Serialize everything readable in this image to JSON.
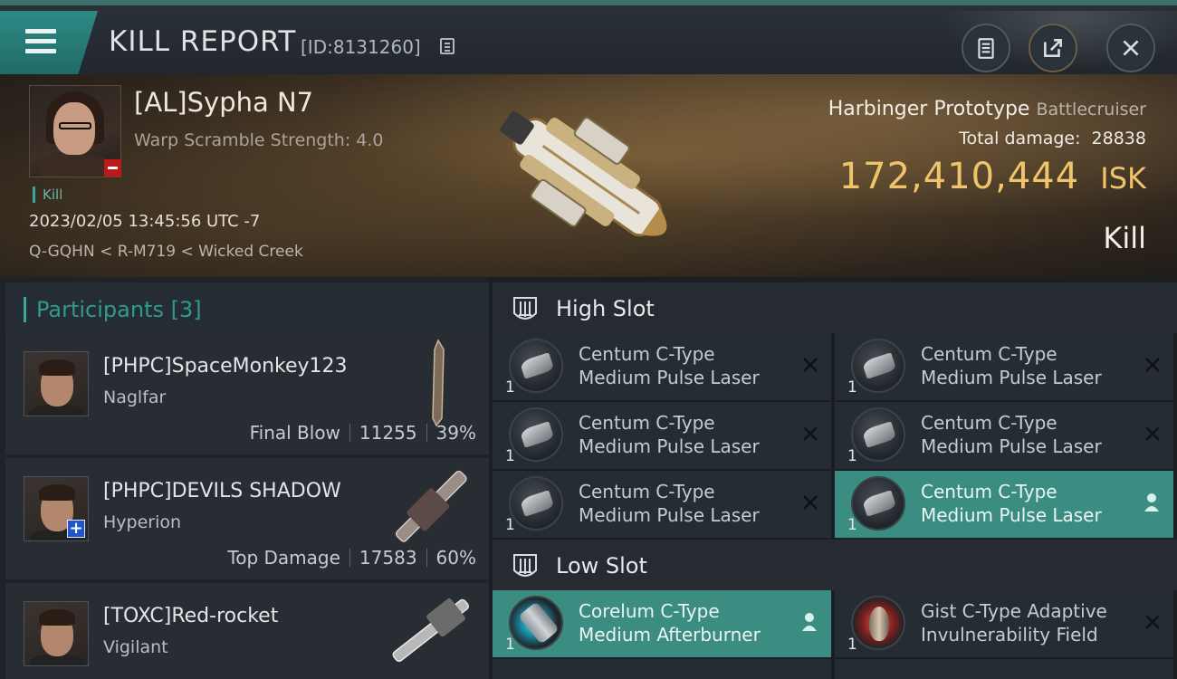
{
  "header": {
    "title": "KILL REPORT",
    "report_id": "[ID:8131260]"
  },
  "victim": {
    "name": "[AL]Sypha N7",
    "warp_scramble": "Warp Scramble Strength: 4.0",
    "tag": "Kill",
    "datetime": "2023/02/05 13:45:56 UTC -7",
    "location": "Q-GQHN < R-M719 < Wicked Creek",
    "ship_name": "Harbinger Prototype",
    "ship_class": "Battlecruiser",
    "total_damage_label": "Total damage:",
    "total_damage": "28838",
    "isk_value": "172,410,444",
    "isk_unit": "ISK",
    "result": "Kill"
  },
  "participants": {
    "title": "Participants [3]",
    "rows": [
      {
        "name": "[PHPC]SpaceMonkey123",
        "ship": "Naglfar",
        "role": "Final Blow",
        "damage": "11255",
        "percent": "39%"
      },
      {
        "name": "[PHPC]DEVILS SHADOW",
        "ship": "Hyperion",
        "role": "Top Damage",
        "damage": "17583",
        "percent": "60%"
      },
      {
        "name": "[TOXC]Red-rocket",
        "ship": "Vigilant",
        "role": "",
        "damage": "",
        "percent": ""
      }
    ]
  },
  "slots": {
    "high": {
      "title": "High Slot",
      "modules": [
        {
          "line1": "Centum C-Type",
          "line2": "Medium Pulse Laser",
          "qty": "1"
        },
        {
          "line1": "Centum C-Type",
          "line2": "Medium Pulse Laser",
          "qty": "1"
        },
        {
          "line1": "Centum C-Type",
          "line2": "Medium Pulse Laser",
          "qty": "1"
        },
        {
          "line1": "Centum C-Type",
          "line2": "Medium Pulse Laser",
          "qty": "1"
        },
        {
          "line1": "Centum C-Type",
          "line2": "Medium Pulse Laser",
          "qty": "1"
        },
        {
          "line1": "Centum C-Type",
          "line2": "Medium Pulse Laser",
          "qty": "1"
        }
      ]
    },
    "low": {
      "title": "Low Slot",
      "modules": [
        {
          "line1": "Corelum C-Type",
          "line2": "Medium Afterburner",
          "qty": "1"
        },
        {
          "line1": "Gist C-Type Adaptive",
          "line2": "Invulnerability Field",
          "qty": "1"
        }
      ]
    }
  },
  "colors": {
    "accent_teal": "#3b8d82",
    "isk_gold": "#f0c46a",
    "badge_red": "#c01818",
    "badge_blue": "#1f56c9"
  }
}
